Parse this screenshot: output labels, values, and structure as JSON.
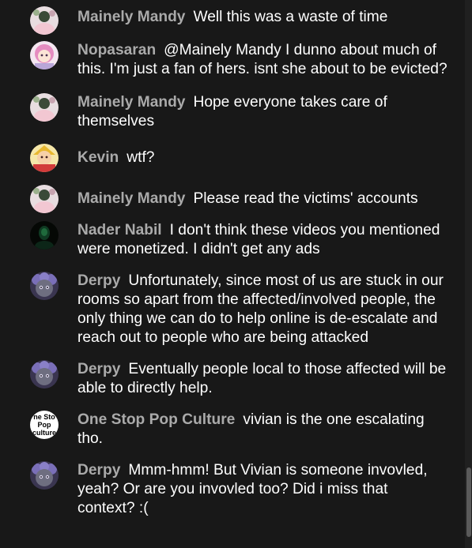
{
  "messages": [
    {
      "author": "Mainely Mandy",
      "text": "Well this was a waste of time",
      "avatar": "mandy-avatar-icon"
    },
    {
      "author": "Nopasaran",
      "text": "@Mainely Mandy I dunno about much of this. I'm just a fan of hers. isnt she about to be evicted?",
      "avatar": "nopasaran-avatar-icon"
    },
    {
      "author": "Mainely Mandy",
      "text": "Hope everyone takes care of themselves",
      "avatar": "mandy-avatar-icon"
    },
    {
      "author": "Kevin",
      "text": "wtf?",
      "avatar": "kevin-avatar-icon"
    },
    {
      "author": "Mainely Mandy",
      "text": "Please read the victims' accounts",
      "avatar": "mandy-avatar-icon"
    },
    {
      "author": "Nader Nabil",
      "text": "I don't think these videos you mentioned were monetized. I didn't get any ads",
      "avatar": "nader-avatar-icon"
    },
    {
      "author": "Derpy",
      "text": "Unfortunately, since most of us are stuck in our rooms so apart from the affected/involved people, the only thing we can do to help online is de-escalate and reach out to people who are being attacked",
      "avatar": "derpy-avatar-icon"
    },
    {
      "author": "Derpy",
      "text": "Eventually people local to those affected will be able to directly help.",
      "avatar": "derpy-avatar-icon"
    },
    {
      "author": "One Stop Pop Culture",
      "text": "vivian is the one escalating tho.",
      "avatar": "one-stop-pop-culture-avatar-icon",
      "avatar_text": [
        "ne Sto",
        "Pop",
        "culture"
      ]
    },
    {
      "author": "Derpy",
      "text": "Mmm-hmm! But Vivian is someone invovled, yeah? Or are you invovled too? Did i miss that context? :(",
      "avatar": "derpy-avatar-icon"
    }
  ],
  "colors": {
    "background": "#181818",
    "author": "#aaaaaa",
    "text": "#ffffff",
    "scroll_thumb": "#5a5a5a"
  }
}
